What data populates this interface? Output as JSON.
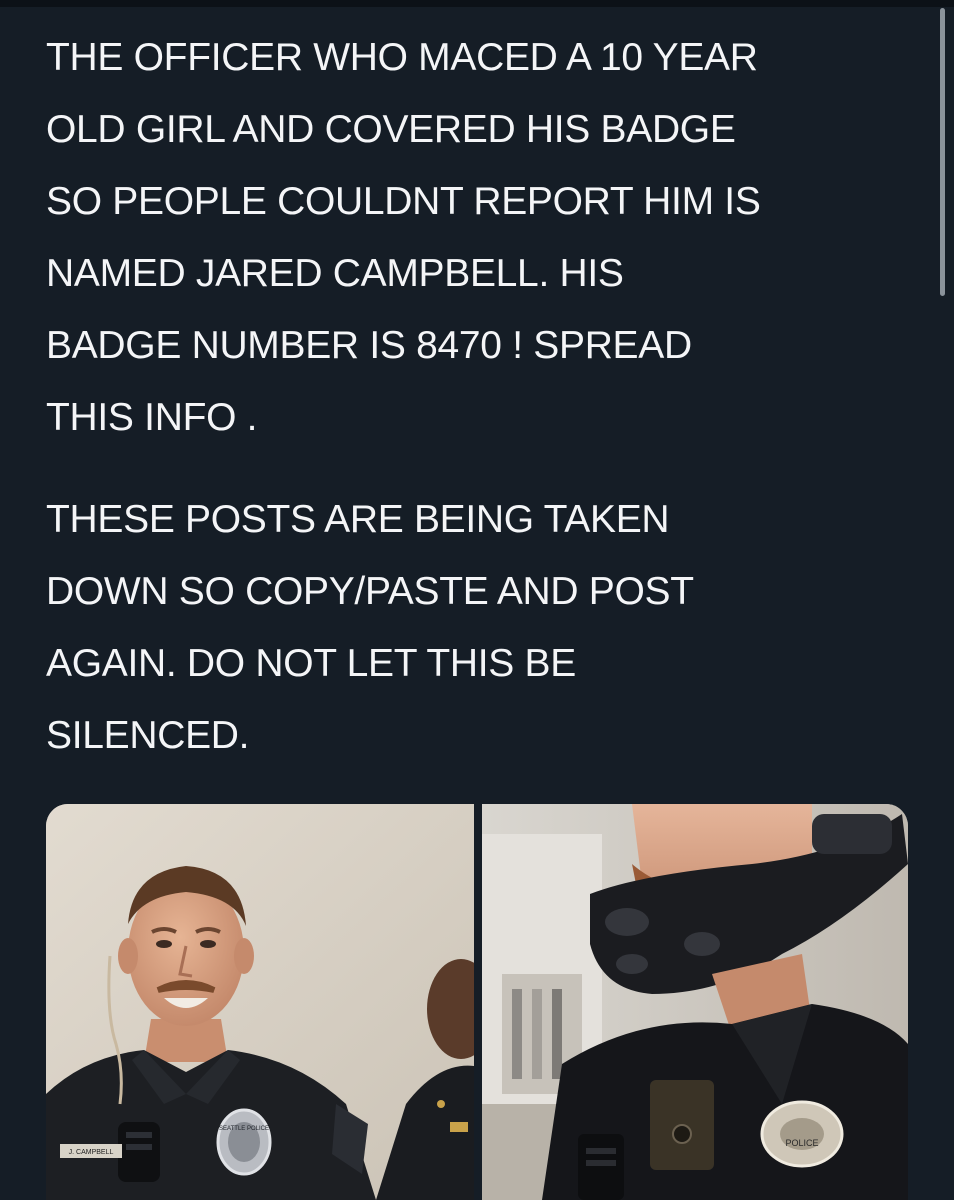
{
  "post": {
    "paragraphs": [
      "THE OFFICER WHO MACED A 10 YEAR\nOLD GIRL AND COVERED HIS BADGE\nSO PEOPLE COULDNT REPORT HIM IS\nNAMED JARED CAMPBELL. HIS\nBADGE NUMBER IS 8470 ! SPREAD\nTHIS INFO .",
      "THESE POSTS ARE BEING TAKEN\nDOWN SO COPY/PASTE AND POST\nAGAIN. DO NOT LET THIS BE\nSILENCED."
    ]
  },
  "media": {
    "left_photo": {
      "name_tag": "J. CAMPBELL",
      "patch_text": "SEATTLE POLICE"
    },
    "right_photo": {
      "badge_text": "POLICE"
    }
  },
  "colors": {
    "background": "#151d26",
    "text": "#f4f5f7",
    "scrollbar": "#8b939b"
  }
}
